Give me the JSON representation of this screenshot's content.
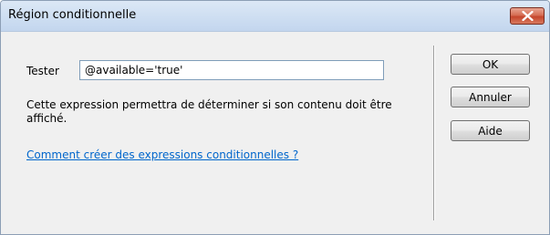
{
  "window": {
    "title": "Région conditionnelle",
    "close_icon": "close-icon"
  },
  "form": {
    "tester_label": "Tester",
    "tester_value": "@available='true'",
    "description": "Cette expression permettra de déterminer si son contenu doit être affiché.",
    "help_link": "Comment créer des expressions conditionnelles ?"
  },
  "buttons": {
    "ok": "OK",
    "cancel": "Annuler",
    "help": "Aide"
  },
  "colors": {
    "link": "#0066cc",
    "close_button": "#c5452b",
    "title_bar": "#cfdff2"
  }
}
